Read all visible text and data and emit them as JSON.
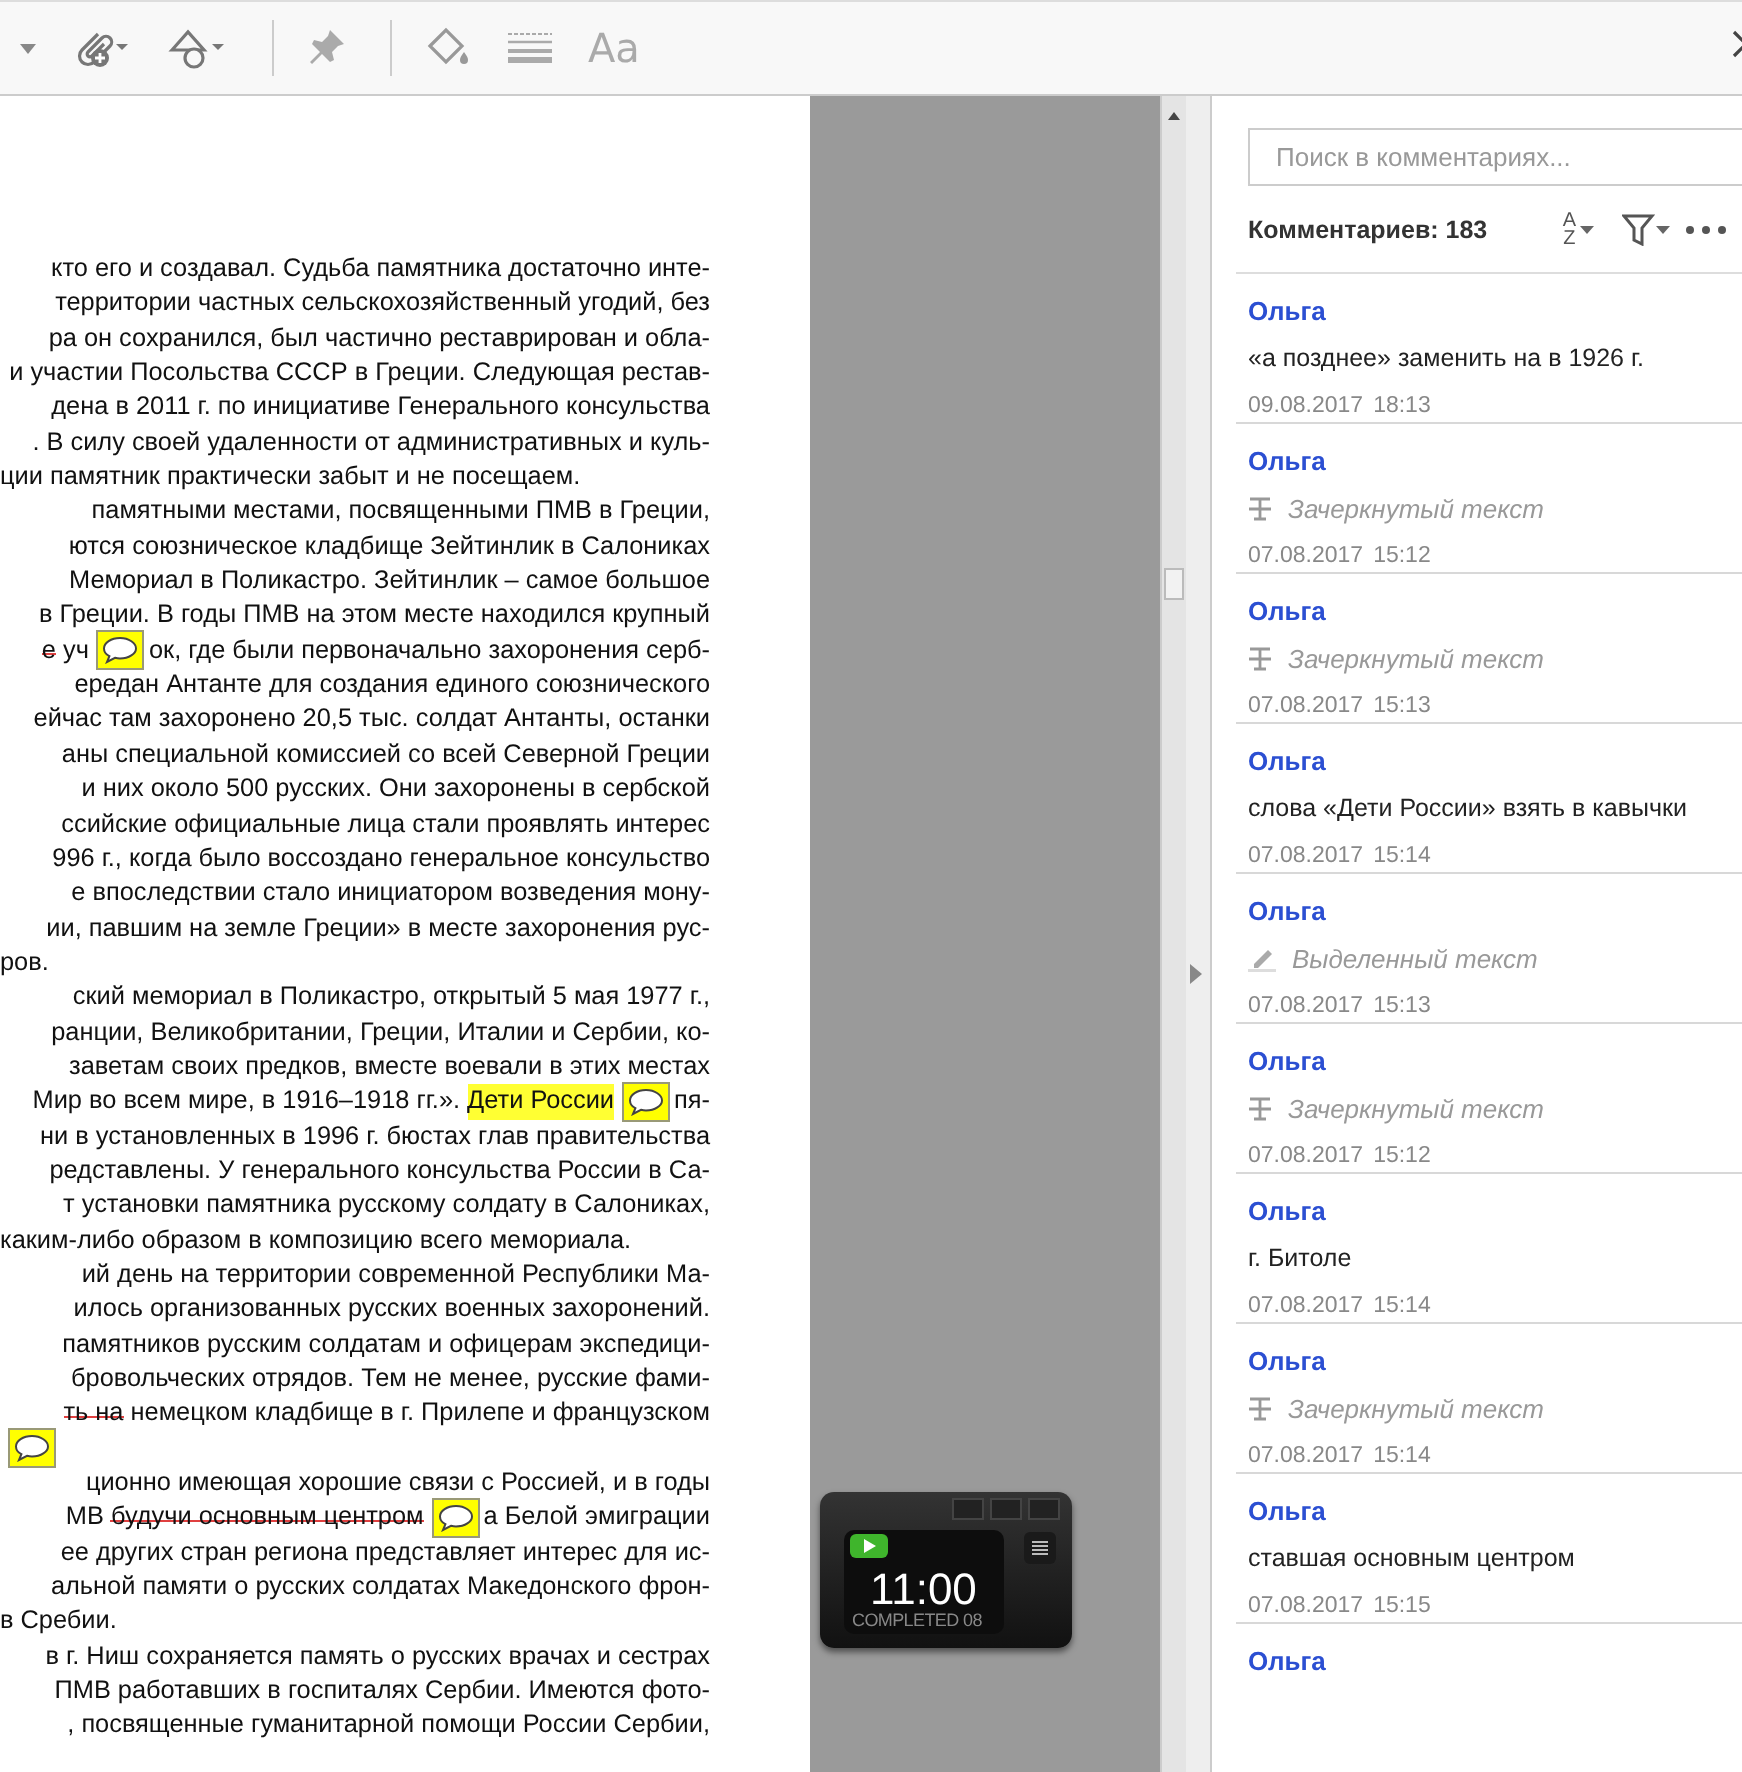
{
  "toolbar": {
    "font_button": "Aa"
  },
  "document": {
    "lines": [
      {
        "kind": "full",
        "segments": [
          {
            "kind": "plain",
            "text": "кто его и создавал. Судьба памятника достаточно инте-"
          }
        ]
      },
      {
        "kind": "full",
        "segments": [
          {
            "kind": "plain",
            "text": "территории частных сельскохозяйственный угодий, без"
          }
        ]
      },
      {
        "kind": "full",
        "segments": [
          {
            "kind": "plain",
            "text": "ра он сохранился, был частично реставрирован и обла-"
          }
        ]
      },
      {
        "kind": "full",
        "segments": [
          {
            "kind": "plain",
            "text": "и участии Посольства СССР в Греции. Следующая рестав-"
          }
        ]
      },
      {
        "kind": "full",
        "segments": [
          {
            "kind": "plain",
            "text": "дена в 2011 г. по инициативе Генерального консульства"
          }
        ]
      },
      {
        "kind": "full",
        "segments": [
          {
            "kind": "plain",
            "text": ". В силу своей удаленности от административных и куль-"
          }
        ]
      },
      {
        "kind": "end",
        "segments": [
          {
            "kind": "plain",
            "text": "ции памятник практически забыт и не посещаем."
          }
        ]
      },
      {
        "kind": "full",
        "segments": [
          {
            "kind": "plain",
            "text": "памятными местами, посвященными ПМВ в Греции,"
          }
        ]
      },
      {
        "kind": "full",
        "segments": [
          {
            "kind": "plain",
            "text": "ются союзническое кладбище Зейтинлик в Салониках"
          }
        ]
      },
      {
        "kind": "full",
        "segments": [
          {
            "kind": "plain",
            "text": "Мемориал в Поликастро. Зейтинлик – самое большое"
          }
        ]
      },
      {
        "kind": "full",
        "segments": [
          {
            "kind": "plain",
            "text": "в Греции. В годы ПМВ на этом месте находился крупный"
          }
        ]
      },
      {
        "kind": "full",
        "segments": [
          {
            "kind": "struck",
            "text": "е"
          },
          {
            "kind": "plain",
            "text": " уч"
          },
          {
            "kind": "note"
          },
          {
            "kind": "plain",
            "text": "ок, где были первоначально захоронения серб-"
          }
        ]
      },
      {
        "kind": "full",
        "segments": [
          {
            "kind": "plain",
            "text": "ередан Антанте для создания единого союзнического"
          }
        ]
      },
      {
        "kind": "full",
        "segments": [
          {
            "kind": "plain",
            "text": "ейчас там захоронено 20,5 тыс. солдат Антанты, останки"
          }
        ]
      },
      {
        "kind": "full",
        "segments": [
          {
            "kind": "plain",
            "text": "аны специальной комиссией со всей Северной Греции"
          }
        ]
      },
      {
        "kind": "full",
        "segments": [
          {
            "kind": "plain",
            "text": "и них около 500 русских. Они захоронены в сербской"
          }
        ]
      },
      {
        "kind": "full",
        "segments": [
          {
            "kind": "plain",
            "text": "ссийские официальные лица стали проявлять интерес"
          }
        ]
      },
      {
        "kind": "full",
        "segments": [
          {
            "kind": "plain",
            "text": "996 г., когда было воссоздано генеральное консульство"
          }
        ]
      },
      {
        "kind": "full",
        "segments": [
          {
            "kind": "plain",
            "text": "е впоследствии стало инициатором возведения мону-"
          }
        ]
      },
      {
        "kind": "full",
        "segments": [
          {
            "kind": "plain",
            "text": "ии, павшим на земле Греции» в месте захоронения рус-"
          }
        ]
      },
      {
        "kind": "end",
        "segments": [
          {
            "kind": "plain",
            "text": "ров."
          }
        ]
      },
      {
        "kind": "full",
        "segments": [
          {
            "kind": "plain",
            "text": "ский мемориал в Поликастро, открытый 5 мая 1977 г.,"
          }
        ]
      },
      {
        "kind": "full",
        "segments": [
          {
            "kind": "plain",
            "text": "ранции, Великобритании, Греции, Италии и Сербии, ко-"
          }
        ]
      },
      {
        "kind": "full",
        "segments": [
          {
            "kind": "plain",
            "text": "заветам своих предков, вместе воевали в этих местах"
          }
        ]
      },
      {
        "kind": "full",
        "segments": [
          {
            "kind": "plain",
            "text": "Мир во всем мире, в 1916–1918 гг.». "
          },
          {
            "kind": "highlight",
            "text": "Дети России"
          },
          {
            "kind": "note"
          },
          {
            "kind": "plain",
            "text": "пя-"
          }
        ]
      },
      {
        "kind": "full",
        "segments": [
          {
            "kind": "plain",
            "text": "ни в установленных в 1996 г. бюстах глав правительства"
          }
        ]
      },
      {
        "kind": "full",
        "segments": [
          {
            "kind": "plain",
            "text": "редставлены. У генерального консульства России в Са-"
          }
        ]
      },
      {
        "kind": "full",
        "segments": [
          {
            "kind": "plain",
            "text": "т установки памятника русскому солдату в Салониках,"
          }
        ]
      },
      {
        "kind": "end",
        "segments": [
          {
            "kind": "plain",
            "text": "каким-либо образом в композицию всего мемориала."
          }
        ]
      },
      {
        "kind": "full",
        "segments": [
          {
            "kind": "plain",
            "text": "ий день на территории современной Республики Ма-"
          }
        ]
      },
      {
        "kind": "full",
        "segments": [
          {
            "kind": "plain",
            "text": "илось организованных русских военных захоронений."
          }
        ]
      },
      {
        "kind": "full",
        "segments": [
          {
            "kind": "plain",
            "text": "памятников русским солдатам и офицерам экспедици-"
          }
        ]
      },
      {
        "kind": "full",
        "segments": [
          {
            "kind": "plain",
            "text": "бровольческих отрядов. Тем не менее, русские фами-"
          }
        ]
      },
      {
        "kind": "full",
        "segments": [
          {
            "kind": "struck",
            "text": "ть на"
          },
          {
            "kind": "plain",
            "text": " немецком кладбище в г. Прилепе и французском"
          }
        ]
      },
      {
        "kind": "end",
        "segments": [
          {
            "kind": "note"
          }
        ]
      },
      {
        "kind": "full",
        "segments": [
          {
            "kind": "plain",
            "text": "ционно имеющая хорошие связи с Россией, и в годы"
          }
        ]
      },
      {
        "kind": "full",
        "segments": [
          {
            "kind": "plain",
            "text": "МВ "
          },
          {
            "kind": "struck",
            "text": "будучи основным центром"
          },
          {
            "kind": "note"
          },
          {
            "kind": "plain",
            "text": "а Белой эмиграции"
          }
        ]
      },
      {
        "kind": "full",
        "segments": [
          {
            "kind": "plain",
            "text": "ее других стран региона представляет интерес для ис-"
          }
        ]
      },
      {
        "kind": "full",
        "segments": [
          {
            "kind": "plain",
            "text": "альной памяти о русских солдатах Македонского фрон-"
          }
        ]
      },
      {
        "kind": "end",
        "segments": [
          {
            "kind": "plain",
            "text": "в Сребии."
          }
        ]
      },
      {
        "kind": "full",
        "segments": [
          {
            "kind": "plain",
            "text": "в г. Ниш сохраняется память о русских врачах и сестрах"
          }
        ]
      },
      {
        "kind": "full",
        "segments": [
          {
            "kind": "plain",
            "text": "ПМВ работавших в госпиталях Сербии. Имеются фото-"
          }
        ]
      },
      {
        "kind": "full",
        "segments": [
          {
            "kind": "plain",
            "text": ", посвященные гуманитарной помощи России Сербии,"
          }
        ]
      }
    ]
  },
  "timer": {
    "time": "11:00",
    "caption": "COMPLETED 08"
  },
  "comments_panel": {
    "search": {
      "placeholder": "Поиск в комментариях..."
    },
    "count": "Комментариев: 183",
    "sort_letters": [
      "A",
      "Z"
    ],
    "comments": [
      {
        "kind": "note",
        "author": "Ольга",
        "text": "«а позднее» заменить на в 1926 г.",
        "date": "09.08.2017",
        "time": "18:13"
      },
      {
        "kind": "strikeout",
        "author": "Ольга",
        "text": "Зачеркнутый текст",
        "date": "07.08.2017",
        "time": "15:12"
      },
      {
        "kind": "strikeout",
        "author": "Ольга",
        "text": "Зачеркнутый текст",
        "date": "07.08.2017",
        "time": "15:13"
      },
      {
        "kind": "note",
        "author": "Ольга",
        "text": "слова «Дети России» взять в кавычки",
        "date": "07.08.2017",
        "time": "15:14"
      },
      {
        "kind": "highlight",
        "author": "Ольга",
        "text": "Выделенный текст",
        "date": "07.08.2017",
        "time": "15:13"
      },
      {
        "kind": "strikeout",
        "author": "Ольга",
        "text": "Зачеркнутый текст",
        "date": "07.08.2017",
        "time": "15:12"
      },
      {
        "kind": "note",
        "author": "Ольга",
        "text": "г. Битоле",
        "date": "07.08.2017",
        "time": "15:14"
      },
      {
        "kind": "strikeout",
        "author": "Ольга",
        "text": "Зачеркнутый текст",
        "date": "07.08.2017",
        "time": "15:14"
      },
      {
        "kind": "note",
        "author": "Ольга",
        "text": "ставшая основным центром",
        "date": "07.08.2017",
        "time": "15:15"
      },
      {
        "kind": "partial",
        "author": "Ольга"
      }
    ]
  }
}
